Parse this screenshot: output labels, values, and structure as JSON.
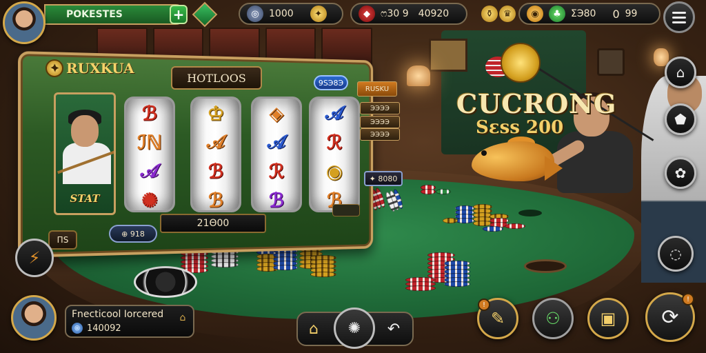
{
  "player": {
    "name": "POKESTES",
    "plus_label": "+"
  },
  "top_bar": {
    "chips_amount": "1000",
    "gems_amount": "ෆ30 9",
    "gems_total": "40920",
    "coins_amount": "ΣЭ80",
    "score_a": "0",
    "score_b": "99"
  },
  "slot_machine": {
    "logo_text": "RUXKUA",
    "header_title": "HOTLOOS",
    "bet_pill": "9SЭ8Э",
    "side_labels": [
      "RUSKU",
      "ЭЭЭЭ",
      "ЭЭЭЭ",
      "ЭЭЭЭ"
    ],
    "portrait_label": "STAT",
    "reels": [
      [
        "ℬ",
        "ℐℕ",
        "𝒜",
        "✺"
      ],
      [
        "♔",
        "𝒜",
        "ℬ",
        "ℬ"
      ],
      [
        "◈",
        "𝒜",
        "ℛ",
        "ℬ"
      ],
      [
        "𝒜",
        "ℛ",
        "◉",
        "ℬ"
      ]
    ],
    "right_amount": "✦ 8080",
    "bottom_amount": "21Θ00",
    "bottom_left_amount": "⊕ 918",
    "left_box": "ΠS"
  },
  "jackpot": {
    "title": "CUCRONG",
    "subtitle": "Sεss 200"
  },
  "bottom_left": {
    "title": "Fnecticool Iorcered",
    "amount": "140092"
  },
  "icons": {
    "menu": "menu-icon",
    "home": "home-icon",
    "center": "chip-icon",
    "back": "back-icon"
  }
}
